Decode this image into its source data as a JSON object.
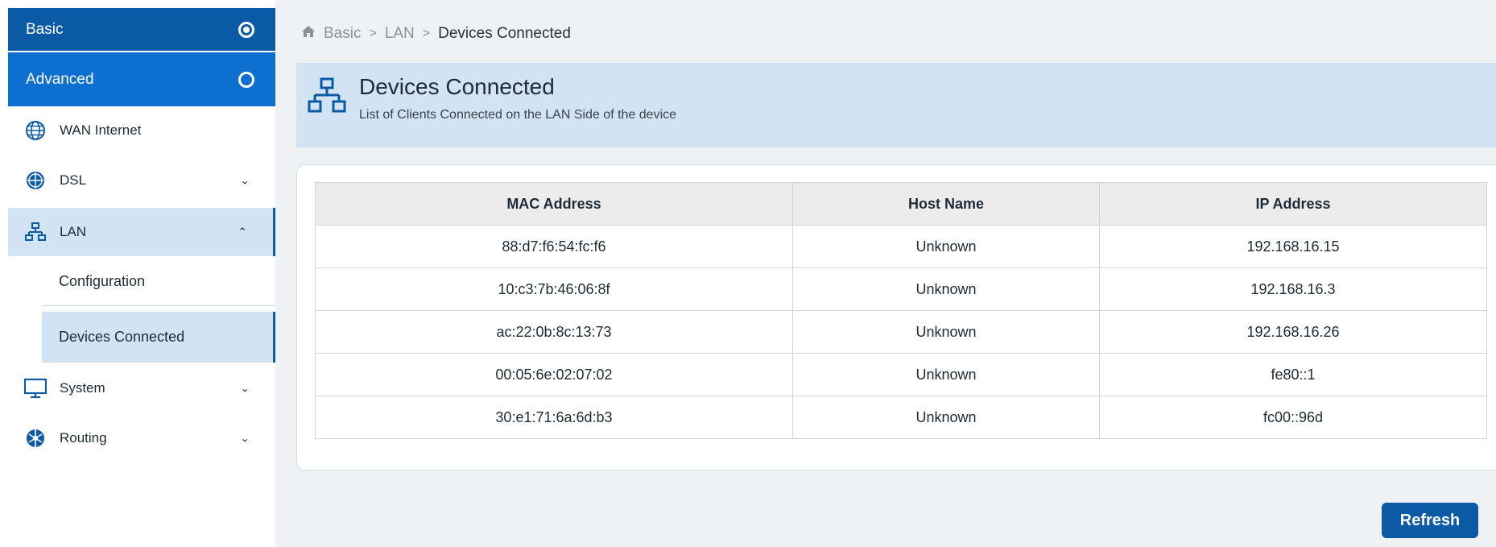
{
  "sidebar": {
    "basic_label": "Basic",
    "advanced_label": "Advanced",
    "items": [
      {
        "label": "WAN Internet",
        "icon": "globe-icon"
      },
      {
        "label": "DSL",
        "icon": "globe-grid-icon"
      },
      {
        "label": "LAN",
        "icon": "network-icon"
      },
      {
        "label": "System",
        "icon": "monitor-icon"
      },
      {
        "label": "Routing",
        "icon": "routing-globe-icon"
      }
    ],
    "lan_sub": {
      "configuration": "Configuration",
      "devices_connected": "Devices Connected"
    }
  },
  "breadcrumb": {
    "home_icon": "home-icon",
    "items": [
      "Basic",
      "LAN",
      "Devices Connected"
    ]
  },
  "header": {
    "title": "Devices Connected",
    "subtitle": "List of Clients Connected on the LAN Side of the device"
  },
  "table": {
    "columns": [
      "MAC Address",
      "Host Name",
      "IP Address"
    ],
    "rows": [
      [
        "88:d7:f6:54:fc:f6",
        "Unknown",
        "192.168.16.15"
      ],
      [
        "10:c3:7b:46:06:8f",
        "Unknown",
        "192.168.16.3"
      ],
      [
        "ac:22:0b:8c:13:73",
        "Unknown",
        "192.168.16.26"
      ],
      [
        "00:05:6e:02:07:02",
        "Unknown",
        "fe80::1"
      ],
      [
        "30:e1:71:6a:6d:b3",
        "Unknown",
        "fc00::96d"
      ]
    ]
  },
  "actions": {
    "refresh_label": "Refresh"
  },
  "colors": {
    "primary": "#0a5aa5",
    "advanced": "#0d6fcf",
    "highlight": "#d2e4f3"
  }
}
